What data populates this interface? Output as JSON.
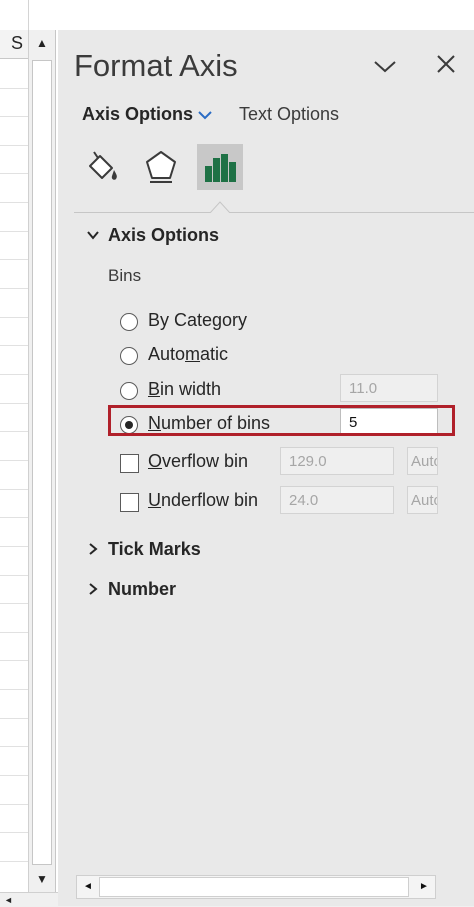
{
  "sheet": {
    "column_header": "S",
    "scroll_up": "▲",
    "scroll_down": "▼",
    "bottom_scroll_left": "◄"
  },
  "pane": {
    "title": "Format Axis",
    "tabs": [
      {
        "label": "Axis Options",
        "active": true
      },
      {
        "label": "Text Options",
        "active": false
      }
    ],
    "icons": [
      "fill-line-icon",
      "effects-icon",
      "axis-options-bar-chart-icon"
    ],
    "sections": {
      "axis_options": {
        "label": "Axis Options",
        "expanded": true,
        "bins_label": "Bins",
        "options": [
          {
            "label_pre": "By Cate",
            "label_acc": "g",
            "label_post": "ory",
            "selected": false
          },
          {
            "label_pre": "Auto",
            "label_acc": "m",
            "label_post": "atic",
            "selected": false
          },
          {
            "label_pre": "",
            "label_acc": "B",
            "label_post": "in width",
            "selected": false,
            "value": "11.0"
          },
          {
            "label_pre": "",
            "label_acc": "N",
            "label_post": "umber of bins",
            "selected": true,
            "value": "5"
          }
        ],
        "overflow": {
          "label_pre": "",
          "label_acc": "O",
          "label_post": "verflow bin",
          "checked": false,
          "value": "129.0",
          "auto": "Auto"
        },
        "underflow": {
          "label_pre": "",
          "label_acc": "U",
          "label_post": "nderflow bin",
          "checked": false,
          "value": "24.0",
          "auto": "Auto"
        }
      },
      "tick_marks": {
        "label": "Tick Marks",
        "expanded": false
      },
      "number": {
        "label": "Number",
        "expanded": false
      }
    },
    "hscroll": {
      "left": "◄",
      "right": "►"
    }
  },
  "colors": {
    "pane_bg": "#e9e9e9",
    "highlight": "#b0202a",
    "accent_blue": "#2b6cc4",
    "chart_icon_green": "#1e7145"
  }
}
